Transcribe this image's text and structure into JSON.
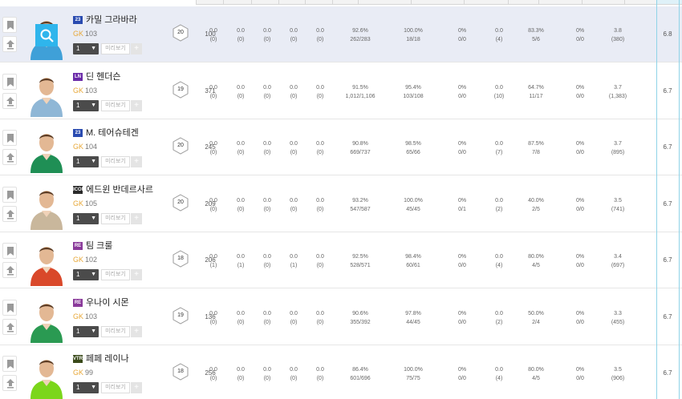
{
  "rows": [
    {
      "season": "23",
      "season_color": "#2a4bb0",
      "name": "카밀 그라바라",
      "position": "GK",
      "ovr": "103",
      "level": "1",
      "preview": "미리보기",
      "plus": "+",
      "grade": "20",
      "apps": "100",
      "s1": [
        "0.0",
        "(0)"
      ],
      "s2": [
        "0.0",
        "(0)"
      ],
      "s3": [
        "0.0",
        "(0)"
      ],
      "s4": [
        "0.0",
        "(0)"
      ],
      "s5": [
        "0.0",
        "(0)"
      ],
      "pass": [
        "92.6%",
        "262/283"
      ],
      "pass2": [
        "100.0%",
        "18/18"
      ],
      "c1": [
        "0%",
        "0/0"
      ],
      "c2": [
        "0.0",
        "(4)"
      ],
      "c3": [
        "83.3%",
        "5/6"
      ],
      "c4": [
        "0%",
        "0/0"
      ],
      "c5": [
        "3.8",
        "(380)"
      ],
      "rating": "6.8",
      "highlight": true,
      "search": true
    },
    {
      "season": "LN",
      "season_color": "#6a2aa8",
      "name": "딘 헨더슨",
      "position": "GK",
      "ovr": "103",
      "level": "1",
      "preview": "미리보기",
      "plus": "+",
      "grade": "19",
      "apps": "371",
      "s1": [
        "0.0",
        "(0)"
      ],
      "s2": [
        "0.0",
        "(0)"
      ],
      "s3": [
        "0.0",
        "(0)"
      ],
      "s4": [
        "0.0",
        "(0)"
      ],
      "s5": [
        "0.0",
        "(0)"
      ],
      "pass": [
        "91.5%",
        "1,012/1,106"
      ],
      "pass2": [
        "95.4%",
        "103/108"
      ],
      "c1": [
        "0%",
        "0/0"
      ],
      "c2": [
        "0.0",
        "(10)"
      ],
      "c3": [
        "64.7%",
        "11/17"
      ],
      "c4": [
        "0%",
        "0/0"
      ],
      "c5": [
        "3.7",
        "(1,383)"
      ],
      "rating": "6.7",
      "highlight": false,
      "search": false
    },
    {
      "season": "23",
      "season_color": "#2a4bb0",
      "name": "M. 테어슈테겐",
      "position": "GK",
      "ovr": "104",
      "level": "1",
      "preview": "미리보기",
      "plus": "+",
      "grade": "20",
      "apps": "245",
      "s1": [
        "0.0",
        "(0)"
      ],
      "s2": [
        "0.0",
        "(0)"
      ],
      "s3": [
        "0.0",
        "(0)"
      ],
      "s4": [
        "0.0",
        "(0)"
      ],
      "s5": [
        "0.0",
        "(0)"
      ],
      "pass": [
        "90.8%",
        "669/737"
      ],
      "pass2": [
        "98.5%",
        "65/66"
      ],
      "c1": [
        "0%",
        "0/0"
      ],
      "c2": [
        "0.0",
        "(7)"
      ],
      "c3": [
        "87.5%",
        "7/8"
      ],
      "c4": [
        "0%",
        "0/0"
      ],
      "c5": [
        "3.7",
        "(895)"
      ],
      "rating": "6.7",
      "highlight": false,
      "search": false
    },
    {
      "season": "ICON",
      "season_color": "#2a2a2a",
      "name": "에드윈 반데르사르",
      "position": "GK",
      "ovr": "105",
      "level": "1",
      "preview": "미리보기",
      "plus": "+",
      "grade": "20",
      "apps": "209",
      "s1": [
        "0.0",
        "(0)"
      ],
      "s2": [
        "0.0",
        "(0)"
      ],
      "s3": [
        "0.0",
        "(0)"
      ],
      "s4": [
        "0.0",
        "(0)"
      ],
      "s5": [
        "0.0",
        "(0)"
      ],
      "pass": [
        "93.2%",
        "547/587"
      ],
      "pass2": [
        "100.0%",
        "45/45"
      ],
      "c1": [
        "0%",
        "0/1"
      ],
      "c2": [
        "0.0",
        "(2)"
      ],
      "c3": [
        "40.0%",
        "2/5"
      ],
      "c4": [
        "0%",
        "0/0"
      ],
      "c5": [
        "3.5",
        "(741)"
      ],
      "rating": "6.7",
      "highlight": false,
      "search": false
    },
    {
      "season": "RE",
      "season_color": "#8a3a9a",
      "name": "팀 크룰",
      "position": "GK",
      "ovr": "102",
      "level": "1",
      "preview": "미리보기",
      "plus": "+",
      "grade": "18",
      "apps": "206",
      "s1": [
        "0.0",
        "(1)"
      ],
      "s2": [
        "0.0",
        "(1)"
      ],
      "s3": [
        "0.0",
        "(0)"
      ],
      "s4": [
        "0.0",
        "(1)"
      ],
      "s5": [
        "0.0",
        "(0)"
      ],
      "pass": [
        "92.5%",
        "528/571"
      ],
      "pass2": [
        "98.4%",
        "60/61"
      ],
      "c1": [
        "0%",
        "0/0"
      ],
      "c2": [
        "0.0",
        "(4)"
      ],
      "c3": [
        "80.0%",
        "4/5"
      ],
      "c4": [
        "0%",
        "0/0"
      ],
      "c5": [
        "3.4",
        "(697)"
      ],
      "rating": "6.7",
      "highlight": false,
      "search": false
    },
    {
      "season": "RE",
      "season_color": "#8a3a9a",
      "name": "우나이 시몬",
      "position": "GK",
      "ovr": "103",
      "level": "1",
      "preview": "미리보기",
      "plus": "+",
      "grade": "19",
      "apps": "136",
      "s1": [
        "0.0",
        "(0)"
      ],
      "s2": [
        "0.0",
        "(0)"
      ],
      "s3": [
        "0.0",
        "(0)"
      ],
      "s4": [
        "0.0",
        "(0)"
      ],
      "s5": [
        "0.0",
        "(0)"
      ],
      "pass": [
        "90.6%",
        "355/392"
      ],
      "pass2": [
        "97.8%",
        "44/45"
      ],
      "c1": [
        "0%",
        "0/0"
      ],
      "c2": [
        "0.0",
        "(2)"
      ],
      "c3": [
        "50.0%",
        "2/4"
      ],
      "c4": [
        "0%",
        "0/0"
      ],
      "c5": [
        "3.3",
        "(455)"
      ],
      "rating": "6.7",
      "highlight": false,
      "search": false
    },
    {
      "season": "VTR",
      "season_color": "#3a4a1a",
      "name": "페페 레이나",
      "position": "GK",
      "ovr": "99",
      "level": "1",
      "preview": "미리보기",
      "plus": "+",
      "grade": "18",
      "apps": "256",
      "s1": [
        "0.0",
        "(0)"
      ],
      "s2": [
        "0.0",
        "(0)"
      ],
      "s3": [
        "0.0",
        "(0)"
      ],
      "s4": [
        "0.0",
        "(0)"
      ],
      "s5": [
        "0.0",
        "(0)"
      ],
      "pass": [
        "86.4%",
        "601/696"
      ],
      "pass2": [
        "100.0%",
        "75/75"
      ],
      "c1": [
        "0%",
        "0/0"
      ],
      "c2": [
        "0.0",
        "(4)"
      ],
      "c3": [
        "80.0%",
        "4/5"
      ],
      "c4": [
        "0%",
        "0/0"
      ],
      "c5": [
        "3.5",
        "(906)"
      ],
      "rating": "6.7",
      "highlight": false,
      "search": false
    }
  ],
  "kit_colors": [
    "#3fa0d8",
    "#8fb7d6",
    "#1f8f55",
    "#c9b79c",
    "#d9482a",
    "#2a9a52",
    "#7bd61b"
  ],
  "icons": {
    "bookmark": "bookmark-icon",
    "upload": "arrow-up-icon",
    "search": "search-icon",
    "chevron": "chevron-down-icon"
  }
}
